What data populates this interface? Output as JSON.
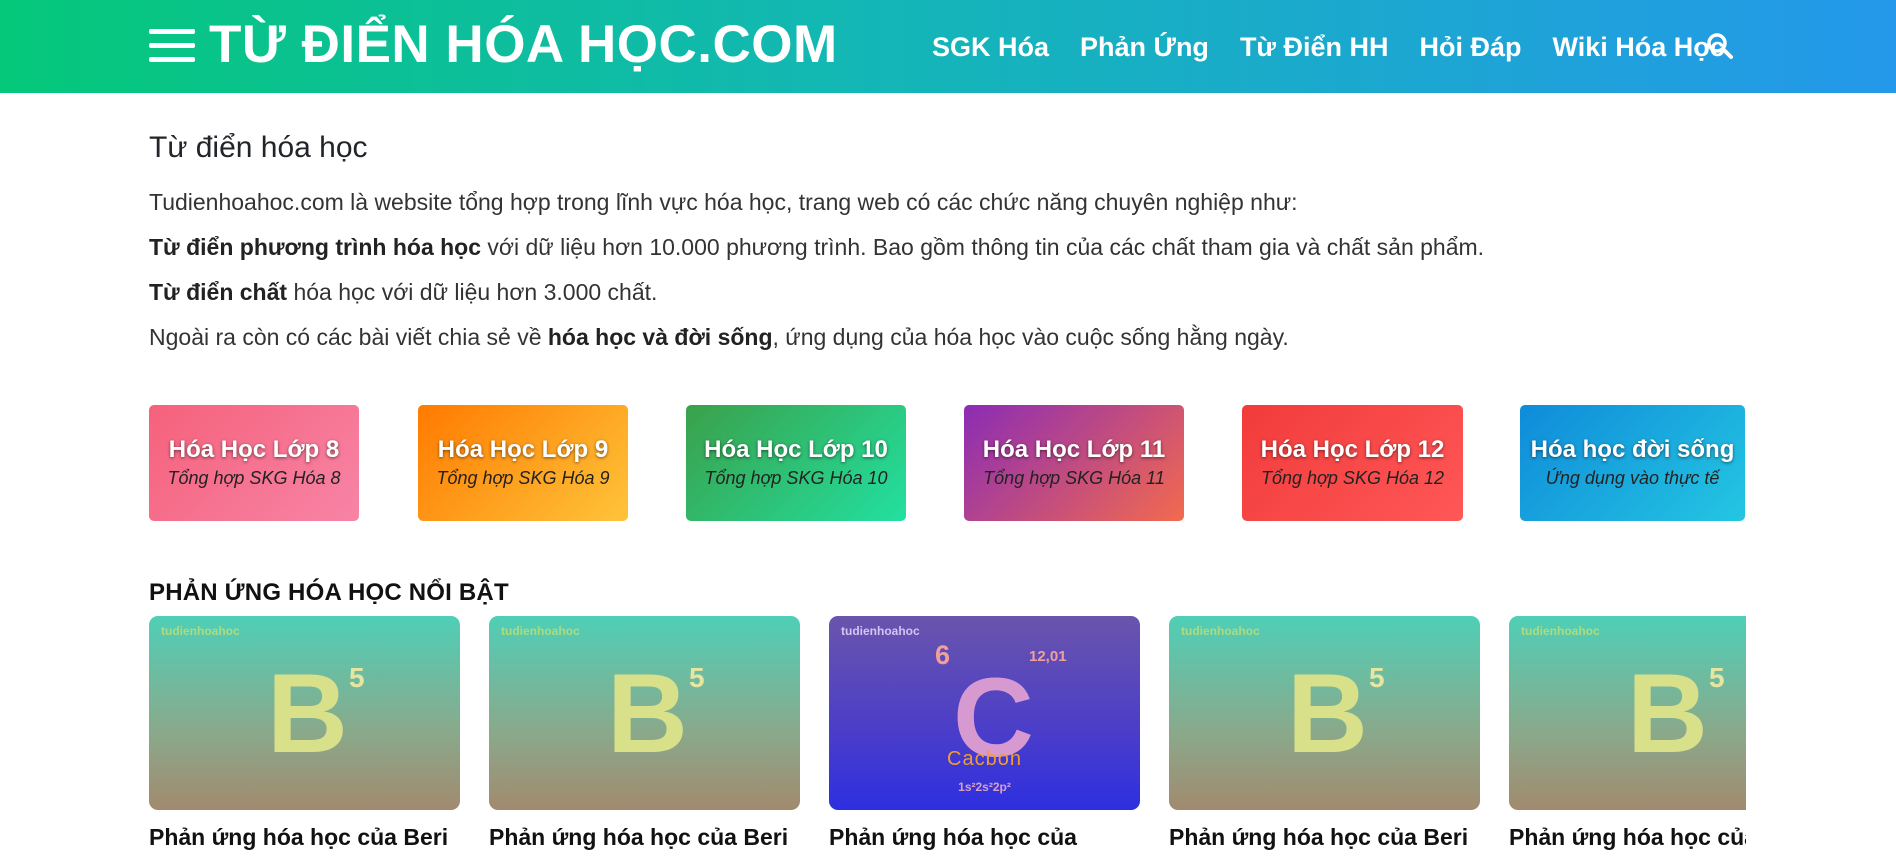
{
  "header": {
    "brand": "TỪ ĐIỂN HÓA HỌC.COM",
    "nav": [
      "SGK Hóa",
      "Phản Ứng",
      "Từ Điển HH",
      "Hỏi Đáp",
      "Wiki Hóa Học"
    ],
    "colors": {
      "gradient_start": "#05c87a",
      "gradient_end": "#2498ea"
    },
    "icons": {
      "menu": "hamburger-menu-icon",
      "search": "search-icon"
    }
  },
  "intro": {
    "title": "Từ điển hóa học",
    "line1": "Tudienhoahoc.com là website tổng hợp trong lĩnh vực hóa học, trang web có các chức năng chuyên nghiệp như:",
    "line2_bold": "Từ điển phương trình hóa học",
    "line2_rest": " với dữ liệu hơn 10.000 phương trình. Bao gồm thông tin của các chất tham gia và chất sản phẩm.",
    "line3_bold": "Từ điển chất",
    "line3_rest": " hóa học với dữ liệu hơn 3.000 chất.",
    "line4_pre": "Ngoài ra còn có các bài viết chia sẻ về ",
    "line4_bold": "hóa học và đời sống",
    "line4_post": ", ứng dụng của hóa học vào cuộc sống hằng ngày."
  },
  "grades": [
    {
      "title": "Hóa Học Lớp 8",
      "subtitle": "Tổng hợp SKG Hóa 8",
      "from": "#f6617b",
      "to": "#f784a6"
    },
    {
      "title": "Hóa Học Lớp 9",
      "subtitle": "Tổng hợp SKG Hóa 9",
      "from": "#ff7a00",
      "to": "#fec43a"
    },
    {
      "title": "Hóa Học Lớp 10",
      "subtitle": "Tổng hợp SKG Hóa 10",
      "from": "#3aa04a",
      "to": "#22e0a0"
    },
    {
      "title": "Hóa Học Lớp 11",
      "subtitle": "Tổng hợp SKG Hóa 11",
      "from": "#8b2cb5",
      "to": "#f36a4e"
    },
    {
      "title": "Hóa Học Lớp 12",
      "subtitle": "Tổng hợp SKG Hóa 12",
      "from": "#f23b3b",
      "to": "#ff5757"
    },
    {
      "title": "Hóa học đời sống",
      "subtitle": "Ứng dụng vào thực tế",
      "from": "#0f8bd9",
      "to": "#24c6e2"
    }
  ],
  "section": {
    "title": "PHẢN ỨNG HÓA HỌC NỔI BẬT"
  },
  "cards": [
    {
      "kind": "beri",
      "watermark": "tudienhoahoc",
      "symbol": "B",
      "number": "5",
      "title": "Phản ứng hóa học của Beri"
    },
    {
      "kind": "beri",
      "watermark": "tudienhoahoc",
      "symbol": "B",
      "number": "5",
      "title": "Phản ứng hóa học của Beri"
    },
    {
      "kind": "cacbon",
      "watermark": "tudienhoahoc",
      "symbol": "C",
      "number": "6",
      "mass": "12,01",
      "name": "Cacbon",
      "config": "1s²2s²2p²",
      "title": "Phản ứng hóa học của"
    },
    {
      "kind": "beri",
      "watermark": "tudienhoahoc",
      "symbol": "B",
      "number": "5",
      "title": "Phản ứng hóa học của Beri"
    },
    {
      "kind": "beri",
      "watermark": "tudienhoahoc",
      "symbol": "B",
      "number": "5",
      "title": "Phản ứng hóa học của"
    }
  ]
}
